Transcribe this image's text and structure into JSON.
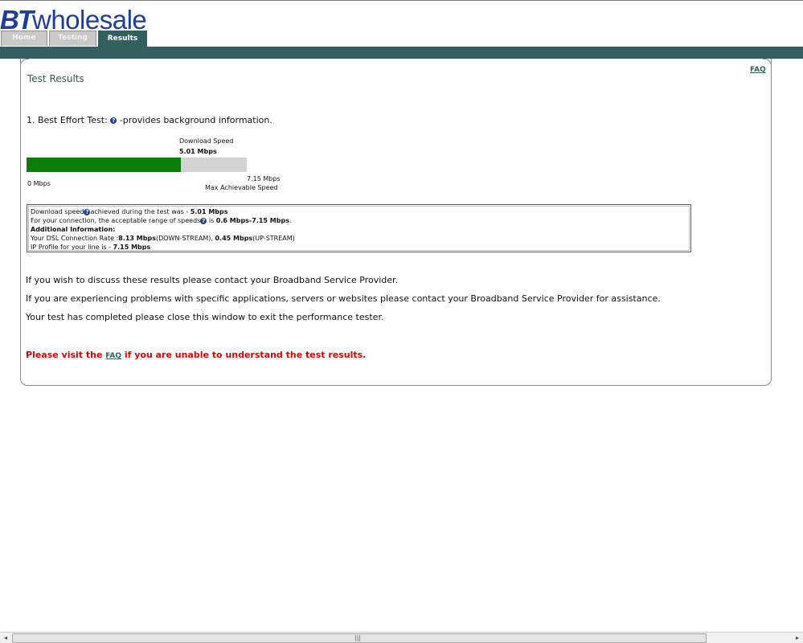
{
  "brand": {
    "bt": "BT",
    "wholesale": "wholesale",
    "color": "#1f3d9a"
  },
  "tabs": [
    {
      "label": "Home",
      "active": false
    },
    {
      "label": "Testing",
      "active": false
    },
    {
      "label": "Results",
      "active": true
    }
  ],
  "colors": {
    "accent": "#33605f",
    "bar_fill": "#0a7e07",
    "bar_track": "#d3d3d3",
    "notice": "#e00000"
  },
  "faq_label": "FAQ",
  "page_title": "Test Results",
  "test": {
    "prefix": "1. Best Effort Test:",
    "help_icon": "?",
    "suffix": " -provides background information."
  },
  "speed": {
    "label": "Download  Speed",
    "value": "5.01 Mbps",
    "min_label": "0 Mbps",
    "max_value": "7.15 Mbps",
    "max_label": "Max Achievable Speed",
    "fraction": 0.7
  },
  "info": {
    "line1_pre": "Download speed",
    "line1_mid": "achieved during the test was - ",
    "line1_val": "5.01 Mbps",
    "line2_pre": "For your connection, the acceptable range of speeds",
    "line2_mid": " is ",
    "line2_val": "0.6 Mbps-7.15 Mbps",
    "line2_end": ".",
    "heading": "Additional Information:",
    "line3_pre": "Your DSL Connection Rate :",
    "line3_down": "8.13 Mbps",
    "line3_down_label": "(DOWN-STREAM), ",
    "line3_up": "0.45 Mbps",
    "line3_up_label": "(UP-STREAM)",
    "line4_pre": "IP Profile for your line is - ",
    "line4_val": "7.15 Mbps"
  },
  "paragraphs": {
    "p1": "If you wish to discuss these results please contact your Broadband Service Provider.",
    "p2": "If you are experiencing problems with specific applications, servers or websites please contact your Broadband Service Provider for assistance.",
    "p3": "Your test has completed please close this window to exit the performance tester."
  },
  "notice": {
    "pre": "Please visit the ",
    "link": "FAQ",
    "post": " if you are unable to understand the test results."
  },
  "scrollbar": {
    "left_arrow": "◂",
    "right_arrow": "▸",
    "grip": "|||"
  }
}
